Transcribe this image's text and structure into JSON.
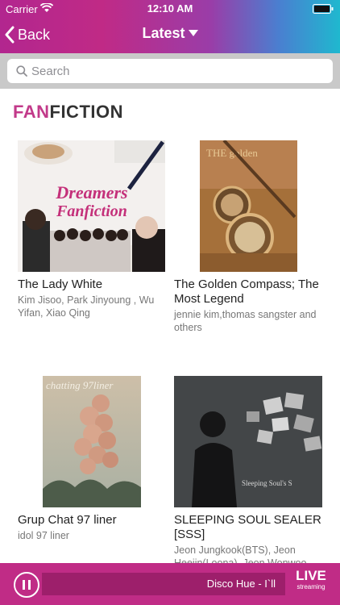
{
  "status_bar": {
    "carrier": "Carrier",
    "time": "12:10 AM"
  },
  "nav": {
    "back_label": "Back",
    "title": "Latest"
  },
  "search": {
    "placeholder": "Search"
  },
  "section": {
    "title_accent": "FAN",
    "title_rest": "FICTION"
  },
  "stories": [
    {
      "title": "The Lady White",
      "authors": "Kim Jisoo, Park Jinyoung , Wu Yifan, Xiao Qing",
      "cover_text_1": "Dreamers",
      "cover_text_2": "Fanfiction"
    },
    {
      "title": "The Golden Compass; The Most Legend",
      "authors": "jennie kim,thomas sangster and others",
      "cover_text": "THE golden"
    },
    {
      "title": "Grup Chat 97 liner",
      "authors": "idol 97 liner",
      "cover_text": "chatting 97liner"
    },
    {
      "title": "SLEEPING SOUL SEALER [SSS]",
      "authors": "Jeon Jungkook(BTS), Jeon Heejin(Loona), Jeon Wonwoo",
      "cover_text": "Sleeping Soul's S"
    }
  ],
  "player": {
    "now_playing": "Disco Hue - I`ll",
    "live_label": "LIVE",
    "live_sub": "streaming"
  },
  "colors": {
    "accent": "#c02c86",
    "player_bar": "#9d1f6b"
  }
}
